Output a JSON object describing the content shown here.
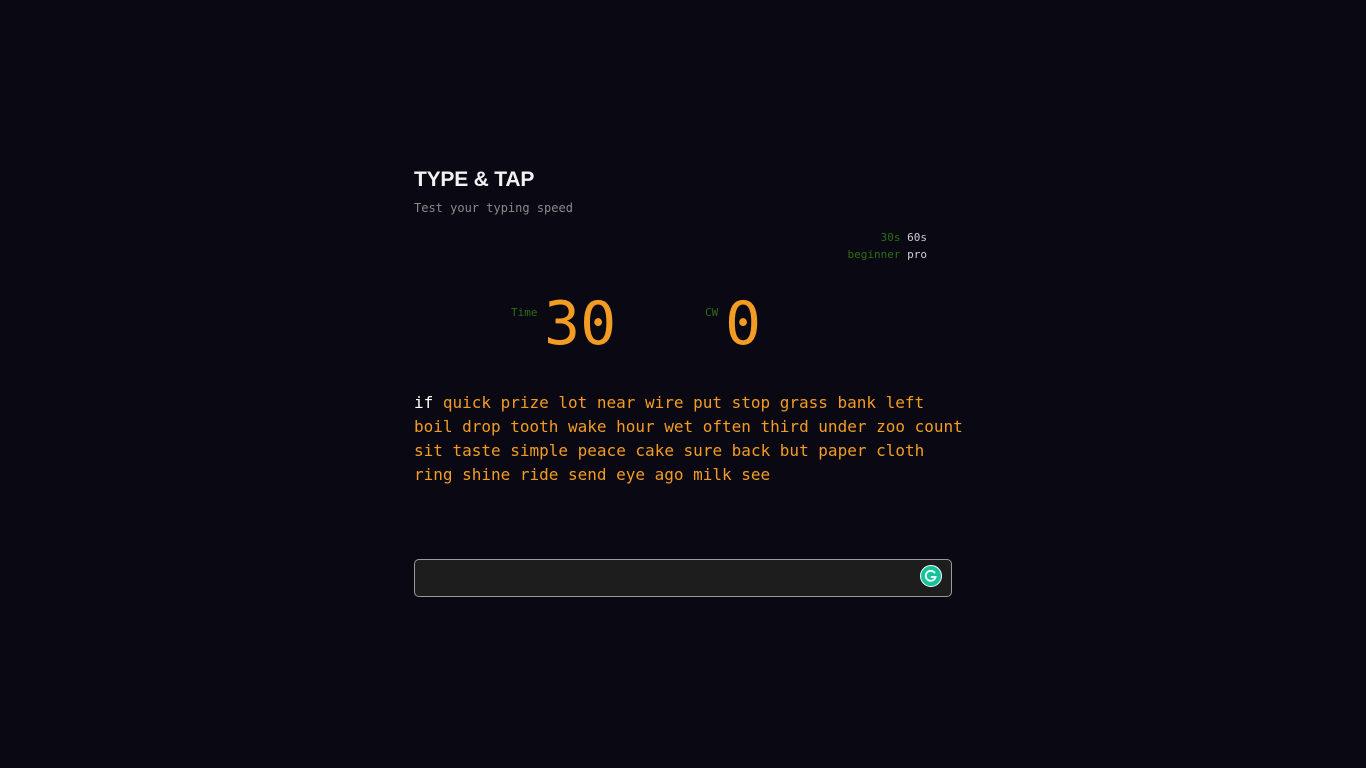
{
  "header": {
    "title": "TYPE & TAP",
    "subtitle": "Test your typing speed"
  },
  "options": {
    "durations": [
      {
        "label": "30s",
        "active": false
      },
      {
        "label": "60s",
        "active": true
      }
    ],
    "levels": [
      {
        "label": "beginner",
        "active": false
      },
      {
        "label": "pro",
        "active": true
      }
    ]
  },
  "stats": {
    "time_label": "Time",
    "time_value": "30",
    "cw_label": "CW",
    "cw_value": "0"
  },
  "words": {
    "lines": [
      [
        "if",
        "quick",
        "prize",
        "lot",
        "near",
        "wire",
        "put",
        "stop",
        "grass",
        "bank",
        "left"
      ],
      [
        "boil",
        "drop",
        "tooth",
        "wake",
        "hour",
        "wet",
        "often",
        "third",
        "under",
        "zoo",
        "count"
      ],
      [
        "sit",
        "taste",
        "simple",
        "peace",
        "cake",
        "sure",
        "back",
        "but",
        "paper",
        "cloth"
      ],
      [
        "ring",
        "shine",
        "ride",
        "send",
        "eye",
        "ago",
        "milk",
        "see"
      ]
    ],
    "current_index": 0
  },
  "input": {
    "value": "",
    "placeholder": ""
  },
  "icons": {
    "grammarly": "grammarly-icon"
  },
  "colors": {
    "background": "#0a0813",
    "accent": "#f39c24",
    "inactive_option": "#2a6e12",
    "active_option": "#cfcfcf",
    "current_word": "#ffffff"
  }
}
